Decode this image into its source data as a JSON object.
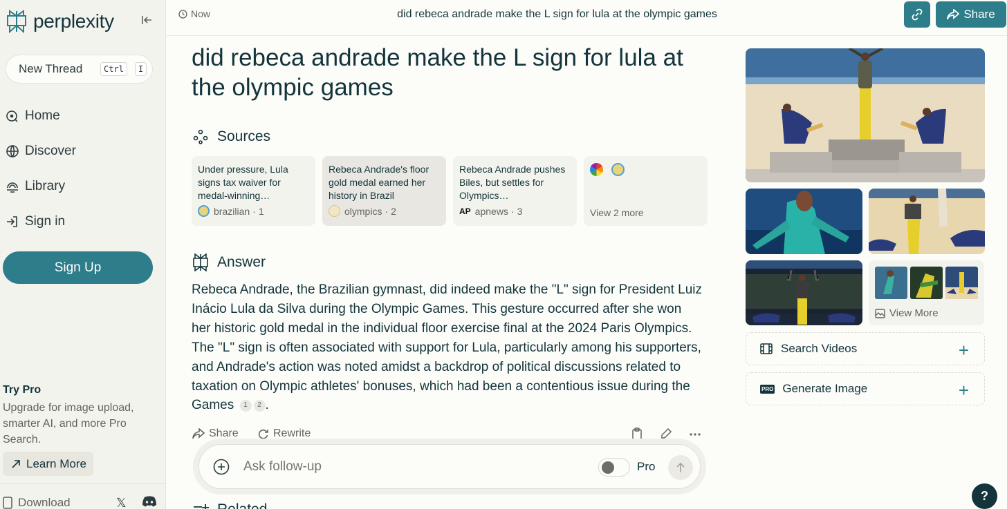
{
  "sidebar": {
    "logo_text": "perplexity",
    "new_thread": {
      "label": "New Thread",
      "shortcut_keys": [
        "Ctrl",
        "I"
      ]
    },
    "nav": [
      {
        "label": "Home",
        "icon": "home-icon"
      },
      {
        "label": "Discover",
        "icon": "globe-icon"
      },
      {
        "label": "Library",
        "icon": "library-icon"
      },
      {
        "label": "Sign in",
        "icon": "sign-in-icon"
      }
    ],
    "signup_label": "Sign Up",
    "try_pro": {
      "title": "Try Pro",
      "description": "Upgrade for image upload, smarter AI, and more Pro Search.",
      "button": "Learn More"
    },
    "download_label": "Download",
    "x_glyph": "𝕏"
  },
  "topbar": {
    "time": "Now",
    "title": "did rebeca andrade make the L sign for lula at the olympic games",
    "share_label": "Share"
  },
  "main": {
    "question": "did rebeca andrade make the L sign for lula at the olympic games",
    "sources_heading": "Sources",
    "sources": [
      {
        "title": "Under pressure, Lula signs tax waiver for medal-winning…",
        "site": "brazilian",
        "index": "1"
      },
      {
        "title": "Rebeca Andrade's floor gold medal earned her history in Brazil",
        "site": "olympics",
        "index": "2"
      },
      {
        "title": "Rebeca Andrade pushes Biles, but settles for Olympics…",
        "site": "apnews",
        "index": "3"
      }
    ],
    "sources_more": "View 2 more",
    "answer_heading": "Answer",
    "answer_text": "Rebeca Andrade, the Brazilian gymnast, did indeed make the \"L\" sign for President Luiz Inácio Lula da Silva during the Olympic Games. This gesture occurred after she won her historic gold medal in the individual floor exercise final at the 2024 Paris Olympics. The \"L\" sign is often associated with support for Lula, particularly among his supporters, and Andrade's action was noted amidst a backdrop of political discussions related to taxation on Olympic athletes' bonuses, which had been a contentious issue during the Games",
    "citations": [
      "1",
      "2"
    ],
    "answer_end": ".",
    "actions": {
      "share": "Share",
      "rewrite": "Rewrite"
    },
    "followup": {
      "placeholder": "Ask follow-up",
      "pro_label": "Pro"
    },
    "related_heading": "Related"
  },
  "right": {
    "view_more_images": "View More",
    "search_videos": "Search Videos",
    "generate_image": "Generate Image",
    "pro_badge": "PRO"
  },
  "help_label": "?",
  "colors": {
    "accent": "#2e7d8a",
    "text": "#13343b",
    "muted": "#64645e",
    "background": "#fcfcf9",
    "sidebar": "#f3f3ee"
  }
}
